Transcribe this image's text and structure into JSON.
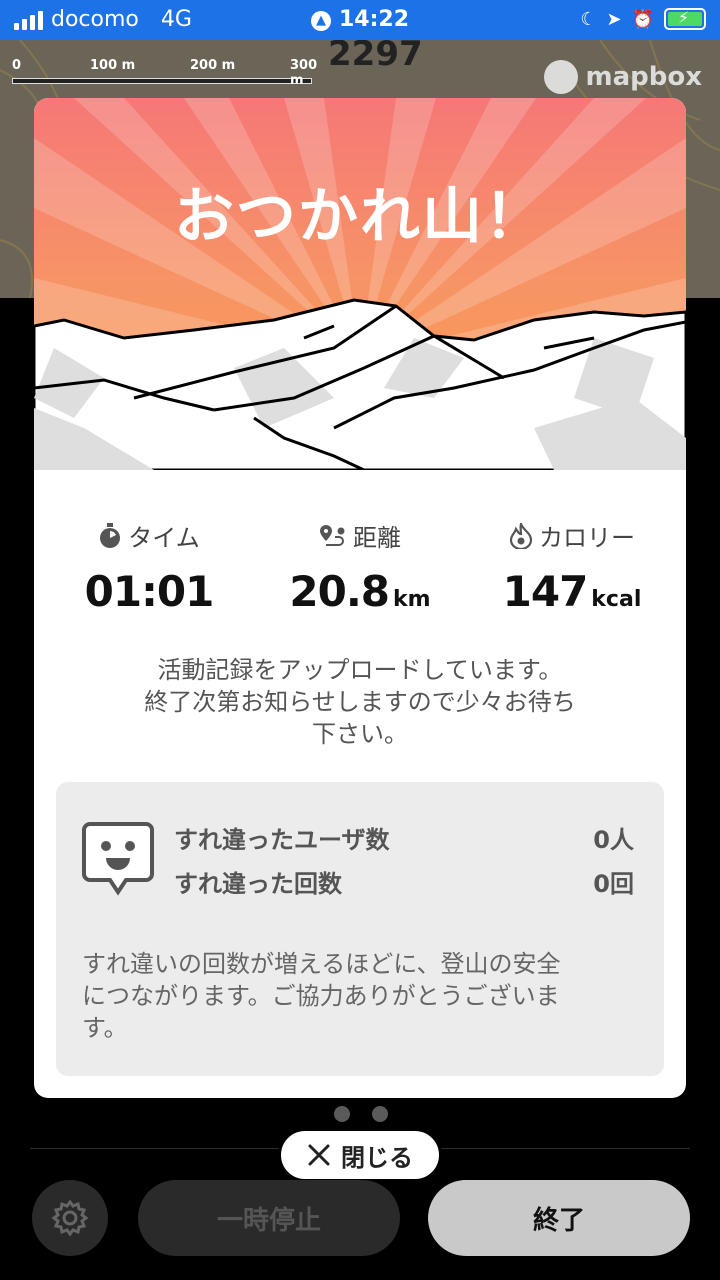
{
  "status_bar": {
    "carrier": "docomo",
    "network": "4G",
    "time": "14:22"
  },
  "map": {
    "scale_labels": [
      "0",
      "100 m",
      "200 m",
      "300 m"
    ],
    "elevation_label": "2297",
    "attribution": "mapbox"
  },
  "summary": {
    "title": "おつかれ山！",
    "stats": {
      "time": {
        "label": "タイム",
        "value": "01:01",
        "unit": ""
      },
      "distance": {
        "label": "距離",
        "value": "20.8",
        "unit": "km"
      },
      "calories": {
        "label": "カロリー",
        "value": "147",
        "unit": "kcal"
      }
    },
    "upload_message": "活動記録をアップロードしています。\n終了次第お知らせしますので少々お待ち\n下さい。",
    "passing": {
      "users_label": "すれ違ったユーザ数",
      "users_value": "0人",
      "times_label": "すれ違った回数",
      "times_value": "0回",
      "note": "すれ違いの回数が増えるほどに、登山の安全\nにつながります。ご協力ありがとうございま\nす。"
    }
  },
  "controls": {
    "close_label": "閉じる",
    "pause_label": "一時停止",
    "end_label": "終了"
  },
  "colors": {
    "status_bar": "#1d72e8",
    "banner_top": "#f57877",
    "banner_bottom": "#fa9b4a",
    "battery": "#4cd964"
  }
}
